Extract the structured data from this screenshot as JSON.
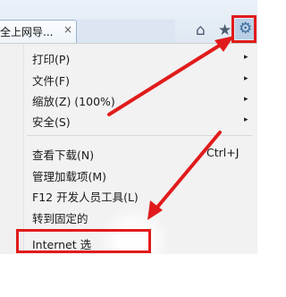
{
  "tab": {
    "title": "全上网导...",
    "close": "×"
  },
  "toolbar": {
    "home": "⌂",
    "favorites": "★",
    "tools": "⚙"
  },
  "menu": {
    "items": [
      {
        "label": "打印(P)",
        "submenu": "▸"
      },
      {
        "label": "文件(F)",
        "submenu": "▸"
      },
      {
        "label": "缩放(Z) (100%)",
        "submenu": "▸"
      },
      {
        "label": "安全(S)",
        "submenu": "▸"
      },
      {
        "label": "查看下载(N)",
        "shortcut": "Ctrl+J"
      },
      {
        "label": "管理加载项(M)"
      },
      {
        "label": "F12 开发人员工具(L)"
      },
      {
        "label": "转到固定的"
      },
      {
        "label": "Internet 选"
      }
    ]
  },
  "colors": {
    "highlight": "#e11b1b",
    "arrow": "#e11b1b"
  }
}
